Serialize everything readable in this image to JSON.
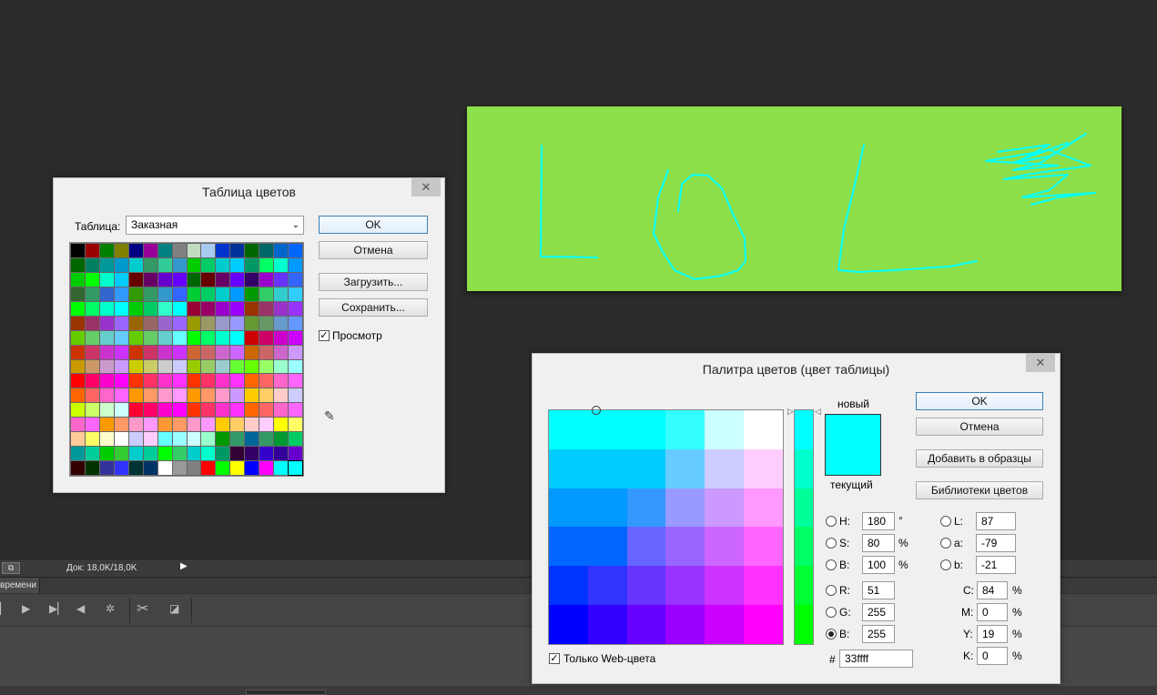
{
  "colors": {
    "workspace": "#2b2b2b",
    "canvas": "#8ee04a",
    "stroke": "#00ffff",
    "dialog_bg": "#f0f0f0"
  },
  "statusbar": {
    "doc_info": "Док: 18,0K/18,0K",
    "expand_arrow": "▶"
  },
  "timeline": {
    "tab_label": "времени"
  },
  "color_table": {
    "title": "Таблица цветов",
    "close": "✕",
    "table_label": "Таблица:",
    "table_value": "Заказная",
    "ok": "OK",
    "cancel": "Отмена",
    "load": "Загрузить...",
    "save": "Сохранить...",
    "preview_label": "Просмотр",
    "preview_checked": true,
    "swatches": [
      "#000000",
      "#990000",
      "#008000",
      "#808000",
      "#000080",
      "#990099",
      "#008080",
      "#808080",
      "#c0dcc0",
      "#a6caf0",
      "#0033cc",
      "#003399",
      "#006600",
      "#006666",
      "#0066cc",
      "#0066ff",
      "#006600",
      "#008060",
      "#009999",
      "#0099cc",
      "#00cccc",
      "#339966",
      "#33cc99",
      "#3399cc",
      "#00cc00",
      "#00cc66",
      "#00cccc",
      "#00ccff",
      "#009966",
      "#00ff66",
      "#00ffcc",
      "#0099ff",
      "#00cc00",
      "#00ff00",
      "#00ffcc",
      "#00ccff",
      "#660000",
      "#660066",
      "#6600cc",
      "#6600ff",
      "#006600",
      "#660000",
      "#660066",
      "#6600ff",
      "#330066",
      "#9900cc",
      "#6633ff",
      "#3366ff",
      "#336633",
      "#339966",
      "#3366cc",
      "#3399ff",
      "#339900",
      "#339966",
      "#3399cc",
      "#3366ff",
      "#00cc33",
      "#00cc66",
      "#00cccc",
      "#0099ff",
      "#009900",
      "#33cc66",
      "#33cccc",
      "#33ccff",
      "#00ff00",
      "#00ff66",
      "#00ffcc",
      "#00ffff",
      "#00cc00",
      "#00cc66",
      "#33ffcc",
      "#00ffff",
      "#990033",
      "#990066",
      "#9900cc",
      "#9900ff",
      "#993300",
      "#993366",
      "#9933cc",
      "#9933ff",
      "#993300",
      "#993366",
      "#9933cc",
      "#9966ff",
      "#996600",
      "#996666",
      "#9966cc",
      "#9966ff",
      "#999900",
      "#999966",
      "#9999cc",
      "#9999ff",
      "#669933",
      "#669966",
      "#6699cc",
      "#6699ff",
      "#66cc00",
      "#66cc66",
      "#66cccc",
      "#66ccff",
      "#66cc00",
      "#66cc66",
      "#66cccc",
      "#66ffff",
      "#00ff00",
      "#00ff66",
      "#00ffcc",
      "#00ffff",
      "#cc0000",
      "#cc0066",
      "#cc00cc",
      "#cc00ff",
      "#cc3300",
      "#cc3366",
      "#cc33cc",
      "#cc33ff",
      "#cc3300",
      "#cc3366",
      "#cc33cc",
      "#cc33ff",
      "#cc6633",
      "#cc6666",
      "#cc66cc",
      "#cc66ff",
      "#cc6600",
      "#cc6666",
      "#cc66cc",
      "#cc99ff",
      "#cc9900",
      "#cc9966",
      "#cc99cc",
      "#cc99ff",
      "#cccc00",
      "#cccc66",
      "#cccccc",
      "#ccccff",
      "#99cc00",
      "#99cc66",
      "#99cccc",
      "#66ff33",
      "#66ff00",
      "#99ff66",
      "#99ffcc",
      "#99ffff",
      "#ff0000",
      "#ff0066",
      "#ff00cc",
      "#ff00ff",
      "#ff3300",
      "#ff3366",
      "#ff33cc",
      "#ff33ff",
      "#ff3300",
      "#ff3366",
      "#ff33cc",
      "#ff33ff",
      "#ff6600",
      "#ff6666",
      "#ff66cc",
      "#ff66ff",
      "#ff6600",
      "#ff6666",
      "#ff66cc",
      "#ff66ff",
      "#ff9900",
      "#ff9966",
      "#ff99cc",
      "#ff99ff",
      "#ff9900",
      "#ff9966",
      "#ff99cc",
      "#cc99ff",
      "#ffcc00",
      "#ffcc66",
      "#ffcccc",
      "#ccccff",
      "#ccff00",
      "#ccff66",
      "#ccffcc",
      "#ccffff",
      "#ff0033",
      "#ff0066",
      "#ff00cc",
      "#ff00ff",
      "#ff3300",
      "#ff3366",
      "#ff33cc",
      "#ff33ff",
      "#ff6600",
      "#ff6666",
      "#ff66cc",
      "#ff66ff",
      "#ff66cc",
      "#ff66ff",
      "#ff9900",
      "#ff9966",
      "#ff99cc",
      "#ff99ff",
      "#ff9933",
      "#ff9966",
      "#ff99cc",
      "#ff99ff",
      "#ffcc00",
      "#ffcc66",
      "#ffcccc",
      "#ffccff",
      "#ffff00",
      "#ffff66",
      "#ffcc99",
      "#ffff66",
      "#ffffcc",
      "#ffffff",
      "#ccccff",
      "#ffccff",
      "#66ffff",
      "#99ffff",
      "#ccffff",
      "#99ffcc",
      "#009900",
      "#339966",
      "#006699",
      "#339966",
      "#009933",
      "#00cc66",
      "#009999",
      "#00cc99",
      "#00cc00",
      "#33cc33",
      "#00cccc",
      "#00cc99",
      "#00ff00",
      "#33cc66",
      "#00cccc",
      "#00ffcc",
      "#009966",
      "#330033",
      "#330066",
      "#3300cc",
      "#330099",
      "#6600cc",
      "#330000",
      "#003300",
      "#333399",
      "#3333ff",
      "#003333",
      "#003366",
      "#ffffff",
      "#999999",
      "#808080",
      "#ff0000",
      "#00ff00",
      "#ffff00",
      "#0000ff",
      "#ff00ff",
      "#00ffff",
      "#00ffff"
    ]
  },
  "color_picker": {
    "title": "Палитра цветов (цвет таблицы)",
    "close": "✕",
    "ok": "OK",
    "cancel": "Отмена",
    "add_to_swatches": "Добавить в образцы",
    "color_libraries": "Библиотеки цветов",
    "new_label": "новый",
    "current_label": "текущий",
    "new_color": "#00ffff",
    "current_color": "#00ffff",
    "fields": {
      "H": {
        "label": "H:",
        "value": "180",
        "unit": "°"
      },
      "S": {
        "label": "S:",
        "value": "80",
        "unit": "%"
      },
      "Bv": {
        "label": "B:",
        "value": "100",
        "unit": "%"
      },
      "R": {
        "label": "R:",
        "value": "51",
        "unit": ""
      },
      "G": {
        "label": "G:",
        "value": "255",
        "unit": ""
      },
      "Bc": {
        "label": "B:",
        "value": "255",
        "unit": ""
      },
      "L": {
        "label": "L:",
        "value": "87",
        "unit": ""
      },
      "a": {
        "label": "a:",
        "value": "-79",
        "unit": ""
      },
      "b": {
        "label": "b:",
        "value": "-21",
        "unit": ""
      },
      "C": {
        "label": "C:",
        "value": "84",
        "unit": "%"
      },
      "M": {
        "label": "M:",
        "value": "0",
        "unit": "%"
      },
      "Y": {
        "label": "Y:",
        "value": "19",
        "unit": "%"
      },
      "K": {
        "label": "K:",
        "value": "0",
        "unit": "%"
      }
    },
    "hash": "#",
    "hex_value": "33ffff",
    "web_only_label": "Только Web-цвета",
    "web_only_checked": true,
    "selected_channel": "Bc",
    "field_rows": [
      [
        "#00ffff",
        "#00ffff",
        "#00ffff",
        "#33ffff",
        "#ccffff",
        "#ffffff"
      ],
      [
        "#00ccff",
        "#00ccff",
        "#00ccff",
        "#66ccff",
        "#ccccff",
        "#ffccff"
      ],
      [
        "#0099ff",
        "#0099ff",
        "#3399ff",
        "#9999ff",
        "#cc99ff",
        "#ff99ff"
      ],
      [
        "#0066ff",
        "#0066ff",
        "#6666ff",
        "#9966ff",
        "#cc66ff",
        "#ff66ff"
      ],
      [
        "#0033ff",
        "#3333ff",
        "#6633ff",
        "#9933ff",
        "#cc33ff",
        "#ff33ff"
      ],
      [
        "#0000ff",
        "#3300ff",
        "#6600ff",
        "#9900ff",
        "#cc00ff",
        "#ff00ff"
      ]
    ],
    "slider_stops": [
      "#00ffff",
      "#00ffcc",
      "#00ff99",
      "#00ff66",
      "#00ff33",
      "#00ff00"
    ]
  }
}
